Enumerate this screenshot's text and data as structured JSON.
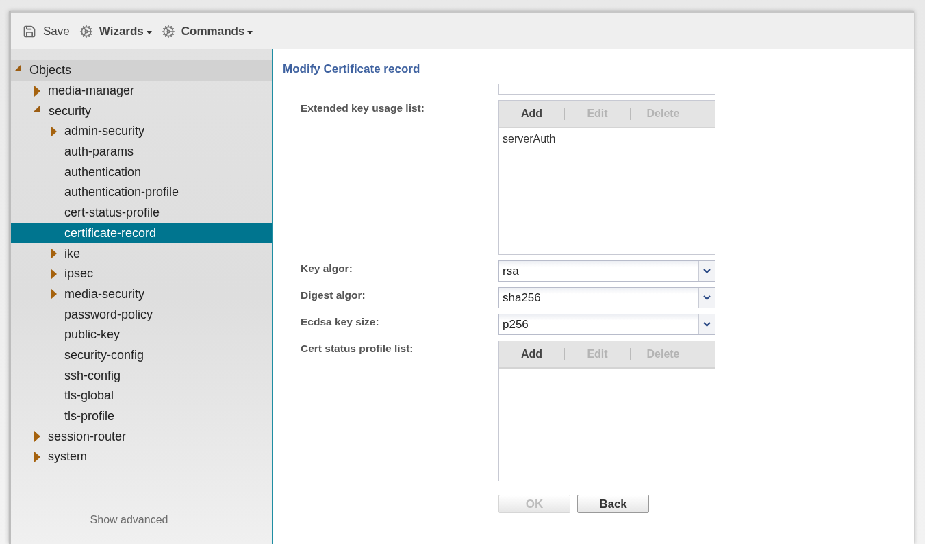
{
  "toolbar": {
    "items": [
      {
        "kind": "save",
        "label": "Save"
      },
      {
        "kind": "menu",
        "label": "Wizards"
      },
      {
        "kind": "menu",
        "label": "Commands"
      }
    ]
  },
  "tree": [
    {
      "kind": "branch",
      "label": "Objects",
      "expanded": true,
      "selected": false,
      "children": [
        {
          "kind": "branch",
          "label": "media-manager",
          "expanded": false,
          "selected": false
        },
        {
          "kind": "branch",
          "label": "security",
          "expanded": true,
          "selected": false,
          "children": [
            {
              "kind": "branch",
              "label": "admin-security",
              "expanded": false,
              "selected": false
            },
            {
              "kind": "leaf",
              "label": "auth-params",
              "selected": false
            },
            {
              "kind": "leaf",
              "label": "authentication",
              "selected": false
            },
            {
              "kind": "leaf",
              "label": "authentication-profile",
              "selected": false
            },
            {
              "kind": "leaf",
              "label": "cert-status-profile",
              "selected": false
            },
            {
              "kind": "leaf",
              "label": "certificate-record",
              "selected": true
            },
            {
              "kind": "branch",
              "label": "ike",
              "expanded": false,
              "selected": false
            },
            {
              "kind": "branch",
              "label": "ipsec",
              "expanded": false,
              "selected": false
            },
            {
              "kind": "branch",
              "label": "media-security",
              "expanded": false,
              "selected": false
            },
            {
              "kind": "leaf",
              "label": "password-policy",
              "selected": false
            },
            {
              "kind": "leaf",
              "label": "public-key",
              "selected": false
            },
            {
              "kind": "leaf",
              "label": "security-config",
              "selected": false
            },
            {
              "kind": "leaf",
              "label": "ssh-config",
              "selected": false
            },
            {
              "kind": "leaf",
              "label": "tls-global",
              "selected": false
            },
            {
              "kind": "leaf",
              "label": "tls-profile",
              "selected": false
            }
          ]
        },
        {
          "kind": "branch",
          "label": "session-router",
          "expanded": false,
          "selected": false
        },
        {
          "kind": "branch",
          "label": "system",
          "expanded": false,
          "selected": false
        }
      ]
    }
  ],
  "show_advanced": "Show advanced",
  "form": {
    "title": "Modify Certificate record",
    "fields": [
      {
        "kind": "partial"
      },
      {
        "kind": "list",
        "label": "Extended key usage list:",
        "buttons": [
          {
            "label": "Add",
            "disabled": false
          },
          {
            "label": "Edit",
            "disabled": true
          },
          {
            "label": "Delete",
            "disabled": true
          }
        ],
        "items": [
          "serverAuth"
        ],
        "cut": false
      },
      {
        "kind": "select",
        "label": "Key algor:",
        "value": "rsa"
      },
      {
        "kind": "select",
        "label": "Digest algor:",
        "value": "sha256"
      },
      {
        "kind": "select",
        "label": "Ecdsa key size:",
        "value": "p256"
      },
      {
        "kind": "list",
        "label": "Cert status profile list:",
        "buttons": [
          {
            "label": "Add",
            "disabled": false
          },
          {
            "label": "Edit",
            "disabled": true
          },
          {
            "label": "Delete",
            "disabled": true
          }
        ],
        "cut": true
      }
    ]
  },
  "buttons": [
    {
      "label": "OK",
      "disabled": true
    },
    {
      "label": "Back",
      "disabled": false
    }
  ]
}
